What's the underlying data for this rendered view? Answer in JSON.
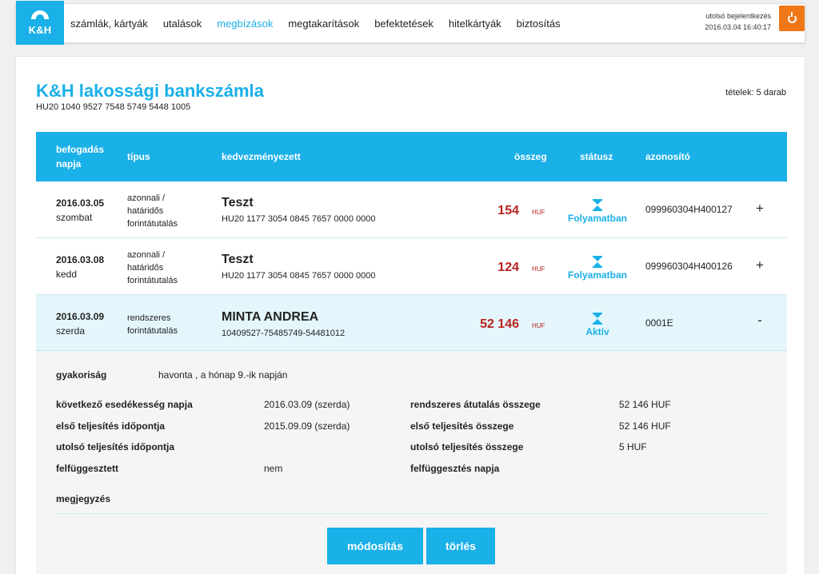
{
  "nav": {
    "logo_text": "K&H",
    "items": [
      {
        "label": "számlák, kártyák",
        "active": false
      },
      {
        "label": "utalások",
        "active": false
      },
      {
        "label": "megbízások",
        "active": true
      },
      {
        "label": "megtakarítások",
        "active": false
      },
      {
        "label": "befektetések",
        "active": false
      },
      {
        "label": "hitelkártyák",
        "active": false
      },
      {
        "label": "biztosítás",
        "active": false
      }
    ],
    "last_login_label": "utolsó bejelentkezés",
    "last_login_value": "2016.03.04 16:40:17",
    "power_icon": "power-icon"
  },
  "account": {
    "title": "K&H lakossági bankszámla",
    "number": "HU20 1040 9527 7548 5749 5448 1005",
    "items_count": "tételek: 5 darab"
  },
  "table": {
    "headers": {
      "date": "befogadás\nnapja",
      "type": "típus",
      "beneficiary": "kedvezményezett",
      "amount": "összeg",
      "status": "státusz",
      "id": "azonosító"
    },
    "rows": [
      {
        "date": "2016.03.05",
        "day": "szombat",
        "type_lines": [
          "azonnali /",
          "határidős",
          "forintátutalás"
        ],
        "beneficiary": "Teszt",
        "beneficiary_account": "HU20 1177 3054 0845 7657 0000 0000",
        "amount": "154",
        "currency": "HUF",
        "status": "Folyamatban",
        "id": "099960304H400127",
        "toggle": "+"
      },
      {
        "date": "2016.03.08",
        "day": "kedd",
        "type_lines": [
          "azonnali /",
          "határidős",
          "forintátutalás"
        ],
        "beneficiary": "Teszt",
        "beneficiary_account": "HU20 1177 3054 0845 7657 0000 0000",
        "amount": "124",
        "currency": "HUF",
        "status": "Folyamatban",
        "id": "099960304H400126",
        "toggle": "+"
      },
      {
        "date": "2016.03.09",
        "day": "szerda",
        "type_lines": [
          "rendszeres",
          "forintátutalás"
        ],
        "beneficiary": "MINTA ANDREA",
        "beneficiary_account": "10409527-75485749-54481012",
        "amount": "52 146",
        "currency": "HUF",
        "status": "Aktív",
        "id": "0001E",
        "toggle": "-"
      }
    ]
  },
  "detail": {
    "frequency_label": "gyakoriság",
    "frequency_value": "havonta , a hónap 9.-ik napján",
    "next_due_label": "következő esedékesség napja",
    "next_due_value": "2016.03.09 (szerda)",
    "first_date_label": "első teljesítés időpontja",
    "first_date_value": "2015.09.09 (szerda)",
    "last_date_label": "utolsó teljesítés időpontja",
    "last_date_value": "",
    "suspended_label": "felfüggesztett",
    "suspended_value": "nem",
    "recurring_amount_label": "rendszeres átutalás összege",
    "recurring_amount_value": "52 146 HUF",
    "first_amount_label": "első teljesítés összege",
    "first_amount_value": "52 146 HUF",
    "last_amount_label": "utolsó teljesítés összege",
    "last_amount_value": "5 HUF",
    "suspension_date_label": "felfüggesztés napja",
    "suspension_date_value": "",
    "note_label": "megjegyzés",
    "modify_button": "módosítás",
    "delete_button": "törlés"
  },
  "colors": {
    "accent": "#1ab0e8",
    "amount": "#b8231e",
    "power": "#f07818"
  }
}
